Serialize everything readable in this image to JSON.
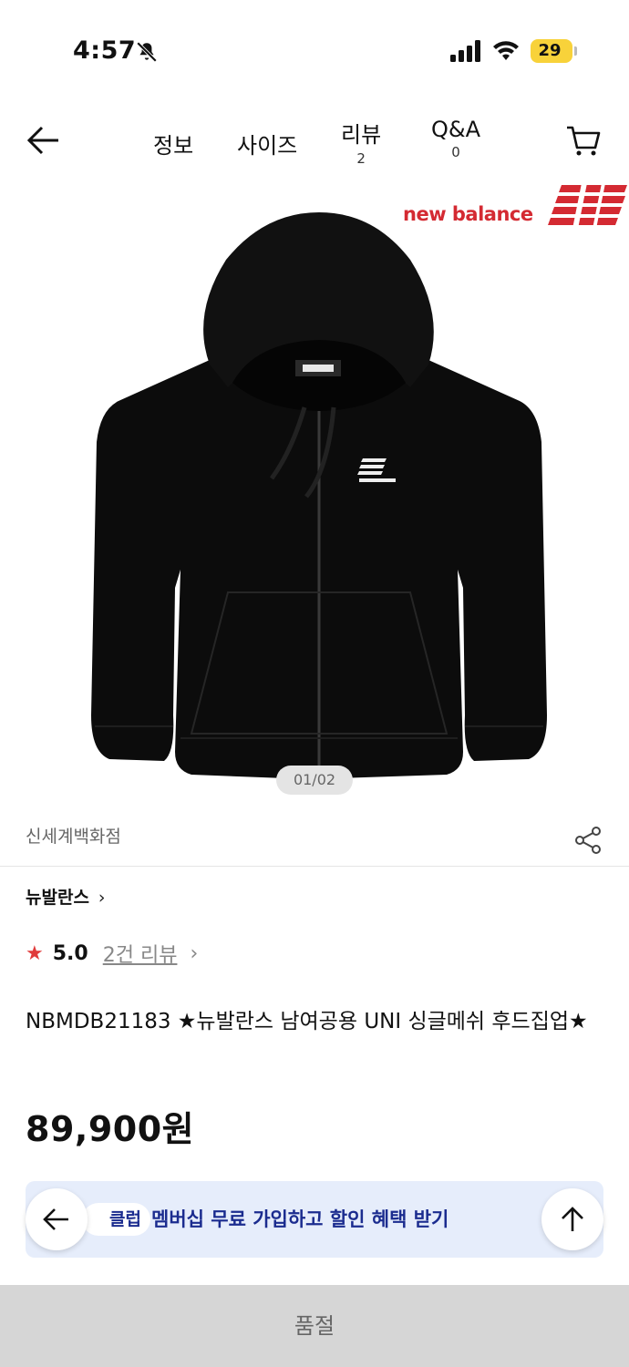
{
  "status_bar": {
    "time": "4:57",
    "battery": "29"
  },
  "nav": {
    "tabs": [
      {
        "label": "정보"
      },
      {
        "label": "사이즈"
      },
      {
        "label": "리뷰",
        "count": "2"
      },
      {
        "label": "Q&A",
        "count": "0"
      }
    ]
  },
  "hero": {
    "brand_wordmark": "new balance",
    "image_alt": "black zip-up hoodie",
    "pager": "01/02"
  },
  "seller": "신세계백화점",
  "brand": "뉴발란스",
  "rating": {
    "score": "5.0",
    "reviews": "2건 리뷰"
  },
  "product_title": "NBMDB21183 ★뉴발란스 남여공용 UNI 싱글메쉬 후드집업★",
  "price": "89,900원",
  "banner": {
    "badge": "클럽",
    "message": "멤버십 무료 가입하고 할인 혜택 받기"
  },
  "soldout_label": "품절",
  "colors": {
    "accent": "#d42a32",
    "banner_bg": "#e6edfb",
    "banner_text": "#1b2c8f",
    "star": "#e03a3a"
  }
}
